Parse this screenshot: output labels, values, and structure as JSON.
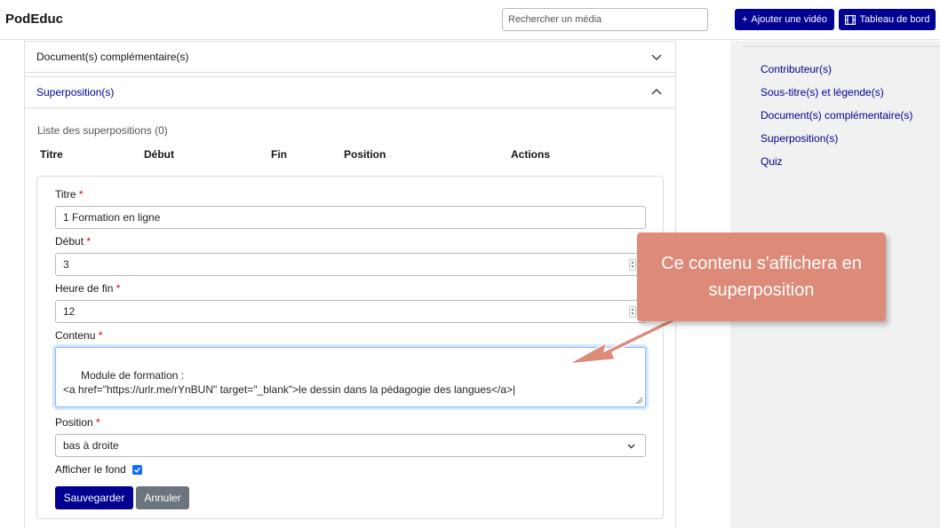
{
  "header": {
    "brand": "PodEduc",
    "search_placeholder": "Rechercher un média",
    "add_video_label": "Ajouter une vidéo",
    "dashboard_label": "Tableau de bord"
  },
  "sidebar": {
    "items": [
      {
        "label": "Contributeur(s)"
      },
      {
        "label": "Sous-titre(s) et légende(s)"
      },
      {
        "label": "Document(s) complémentaire(s)"
      },
      {
        "label": "Superposition(s)"
      },
      {
        "label": "Quiz"
      }
    ]
  },
  "accordion": {
    "documents_label": "Document(s) complémentaire(s)",
    "overlays_label": "Superposition(s)"
  },
  "overlay_list": {
    "title": "Liste des superpositions (0)",
    "columns": [
      "Titre",
      "Début",
      "Fin",
      "Position",
      "Actions"
    ]
  },
  "form": {
    "title_label": "Titre",
    "title_value": "1 Formation en ligne",
    "start_label": "Début",
    "start_value": "3",
    "end_label": "Heure de fin",
    "end_value": "12",
    "content_label": "Contenu",
    "content_value": "Module de formation :\n<a href=\"https://urlr.me/rYnBUN\" target=\"_blank\">le dessin dans la pédagogie des langues</a>|",
    "position_label": "Position",
    "position_value": "bas à droite",
    "background_label": "Afficher le fond",
    "background_checked": true,
    "required_mark": "*",
    "save_label": "Sauvegarder",
    "cancel_label": "Annuler"
  },
  "callout": {
    "text": "Ce contenu s'affichera en superposition",
    "color": "#de8a78"
  },
  "colors": {
    "primary": "#000091",
    "secondary": "#6c757d",
    "required": "#ce0500",
    "sidebar_bg": "#f1f1f1"
  }
}
